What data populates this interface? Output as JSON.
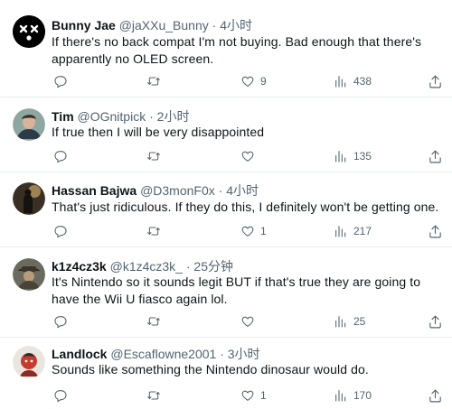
{
  "tweets": [
    {
      "name": "Bunny Jae",
      "handle": "@jaXXu_Bunny",
      "time": "4小时",
      "text": "If there's no back compat I'm not buying. Bad enough that there's apparently no OLED screen.",
      "likes": "9",
      "views": "438",
      "avatar": "black-face-x-eyes"
    },
    {
      "name": "Tim",
      "handle": "@OGnitpick",
      "time": "2小时",
      "text": "If true then I will be very disappointed",
      "likes": "",
      "views": "135",
      "avatar": "man-photo"
    },
    {
      "name": "Hassan Bajwa",
      "handle": "@D3monF0x",
      "time": "4小时",
      "text": "That's just ridiculous. If they do this, I definitely won't be getting one.",
      "likes": "1",
      "views": "217",
      "avatar": "dark-figure"
    },
    {
      "name": "k1z4cz3k",
      "handle": "@k1z4cz3k_",
      "time": "25分钟",
      "text": "It's Nintendo so it sounds legit BUT if that's true they are going to have the Wii U fiasco again lol.",
      "likes": "",
      "views": "25",
      "avatar": "hat-photo"
    },
    {
      "name": "Landlock",
      "handle": "@Escaflowne2001",
      "time": "3小时",
      "text": "Sounds like something the Nintendo dinosaur would do.",
      "likes": "1",
      "views": "170",
      "avatar": "red-character"
    }
  ],
  "separator": "·",
  "colors": {
    "text": "#0f1419",
    "secondary": "#536471",
    "divider": "#e6ecf0"
  },
  "icons": [
    "reply-icon",
    "retweet-icon",
    "like-icon",
    "views-icon",
    "share-icon"
  ]
}
